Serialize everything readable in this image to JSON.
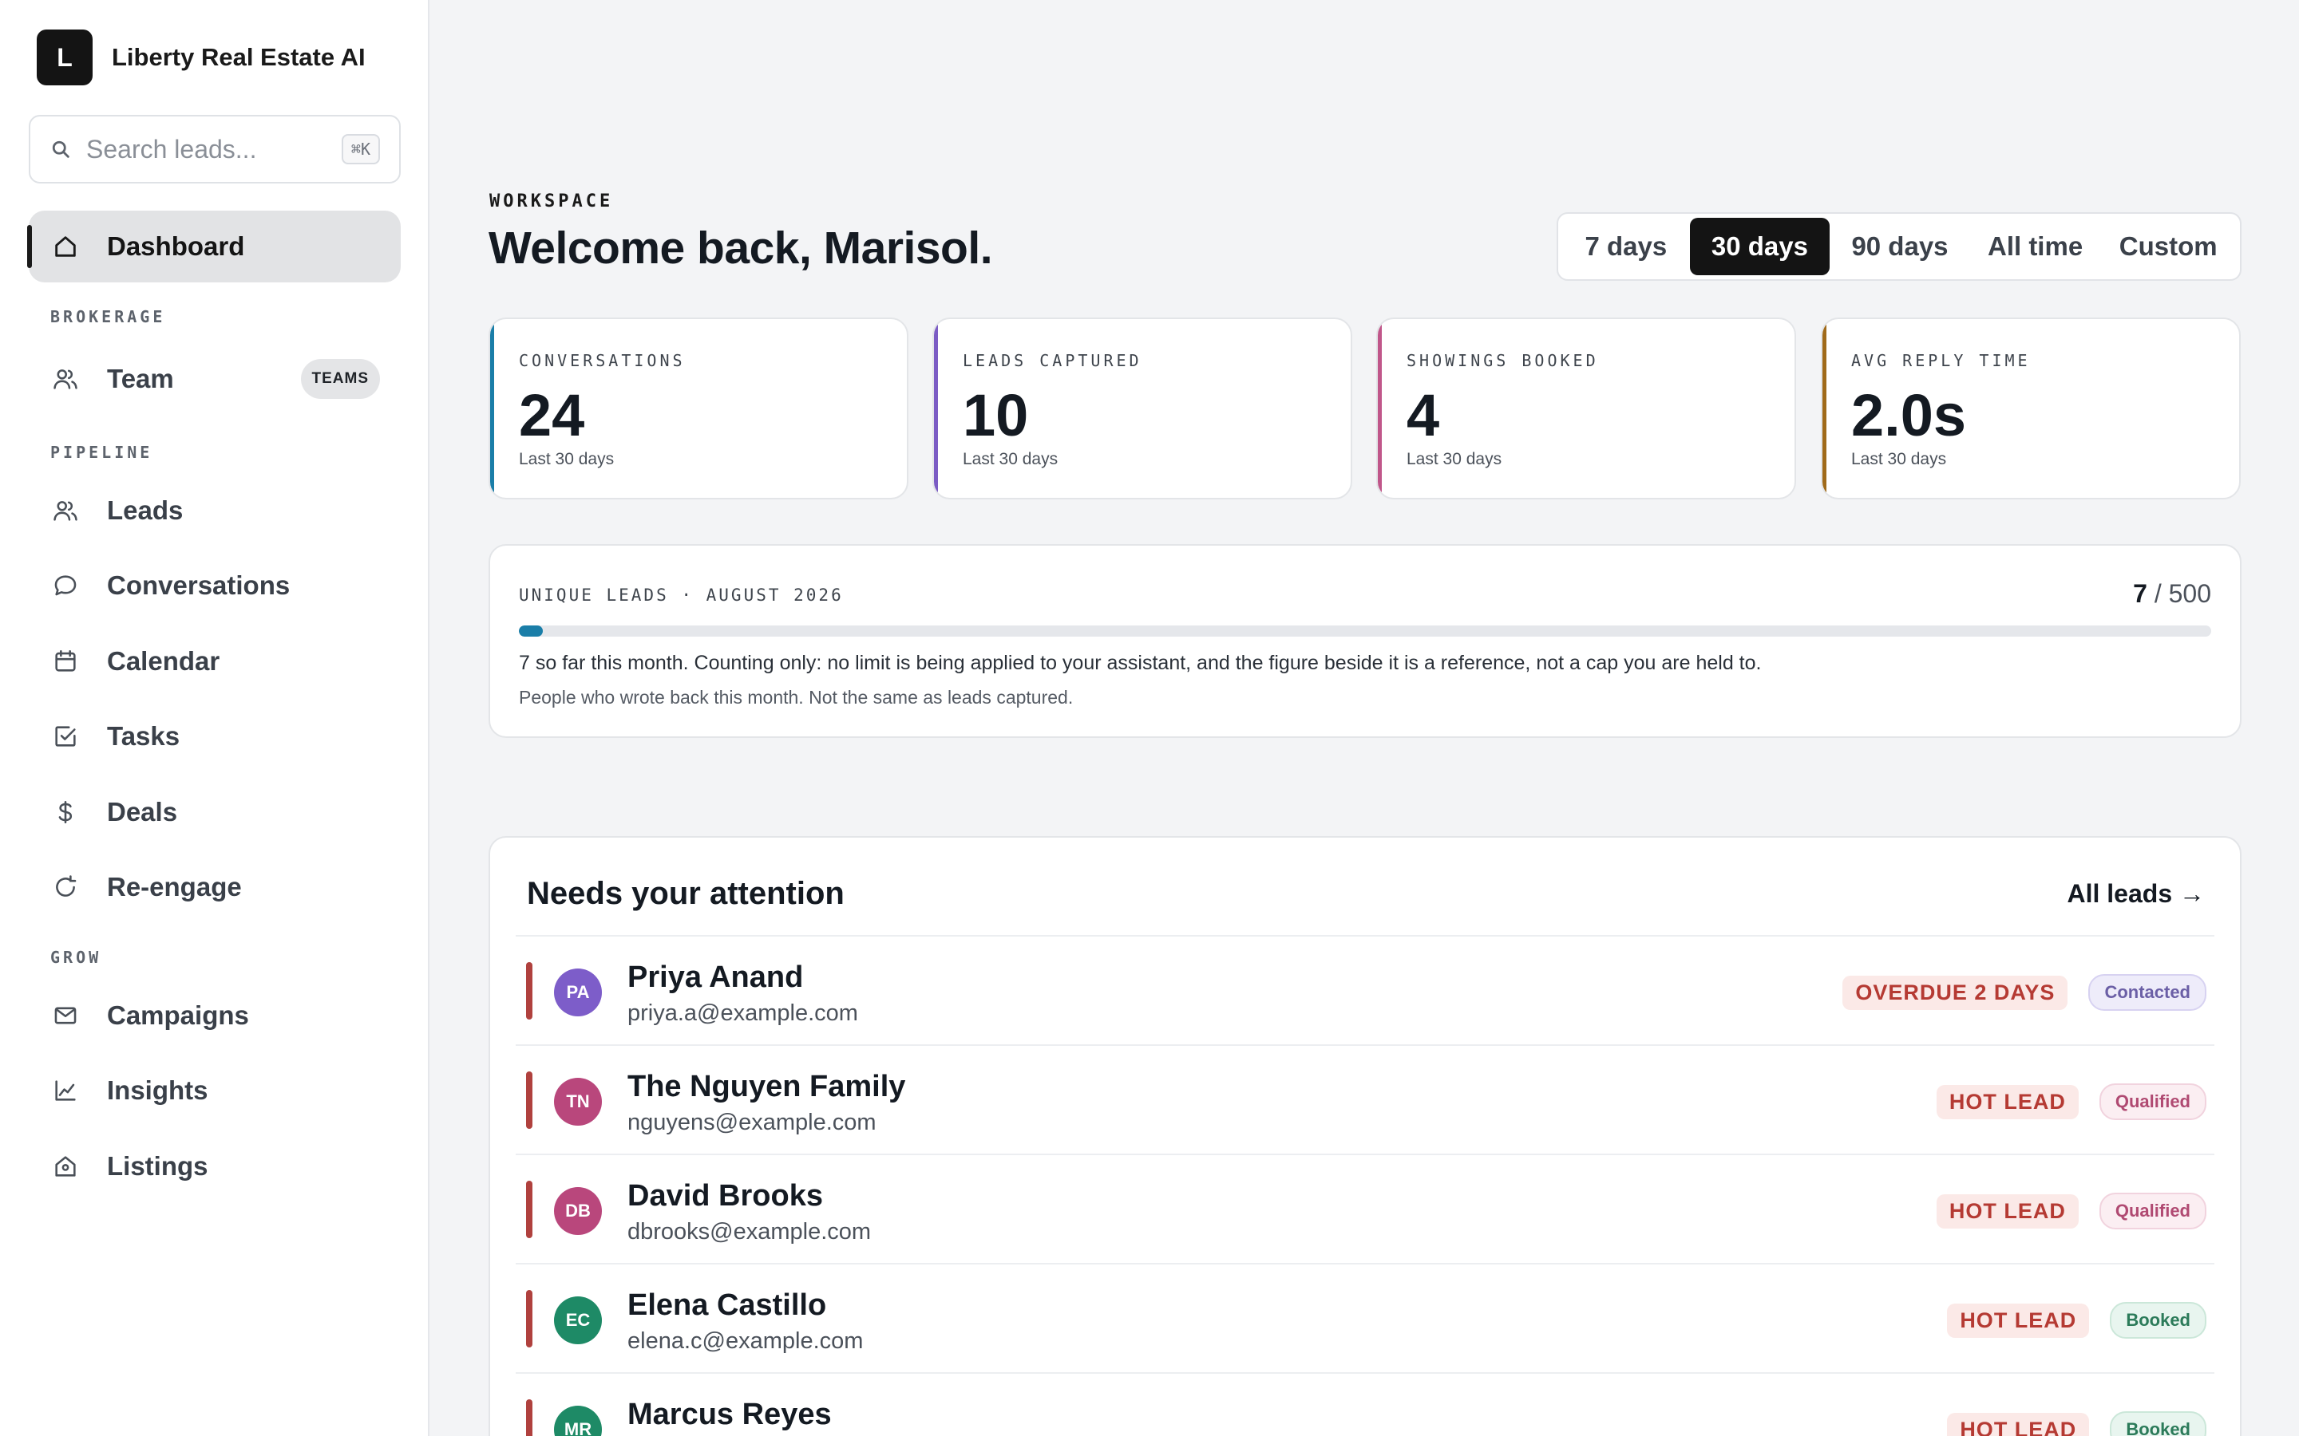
{
  "brand": {
    "logo_letter": "L",
    "name": "Liberty Real Estate AI"
  },
  "search": {
    "placeholder": "Search leads...",
    "shortcut": "⌘K"
  },
  "sidebar": {
    "dashboard": {
      "label": "Dashboard",
      "icon": "home-icon"
    },
    "section_brokerage": "BROKERAGE",
    "team": {
      "label": "Team",
      "icon": "users-icon",
      "badge": "TEAMS"
    },
    "section_pipeline": "PIPELINE",
    "leads": {
      "label": "Leads",
      "icon": "users-icon"
    },
    "conversations": {
      "label": "Conversations",
      "icon": "chat-bubble-icon"
    },
    "calendar": {
      "label": "Calendar",
      "icon": "calendar-icon"
    },
    "tasks": {
      "label": "Tasks",
      "icon": "checkbox-icon"
    },
    "deals": {
      "label": "Deals",
      "icon": "dollar-icon"
    },
    "reengage": {
      "label": "Re-engage",
      "icon": "refresh-icon"
    },
    "section_grow": "GROW",
    "campaigns": {
      "label": "Campaigns",
      "icon": "mail-icon"
    },
    "insights": {
      "label": "Insights",
      "icon": "line-chart-icon"
    },
    "listings": {
      "label": "Listings",
      "icon": "house-icon"
    }
  },
  "header": {
    "eyebrow": "WORKSPACE",
    "welcome": "Welcome back, Marisol."
  },
  "range": {
    "options": [
      "7 days",
      "30 days",
      "90 days",
      "All time",
      "Custom"
    ],
    "selected": "30 days"
  },
  "stats": [
    {
      "label": "CONVERSATIONS",
      "value": "24",
      "sub": "Last 30 days",
      "accent": "#1a7ea8"
    },
    {
      "label": "LEADS CAPTURED",
      "value": "10",
      "sub": "Last 30 days",
      "accent": "#7b5cc4"
    },
    {
      "label": "SHOWINGS BOOKED",
      "value": "4",
      "sub": "Last 30 days",
      "accent": "#c0568a"
    },
    {
      "label": "AVG REPLY TIME",
      "value": "2.0s",
      "sub": "Last 30 days",
      "accent": "#a06a1a"
    }
  ],
  "unique_leads": {
    "label": "UNIQUE LEADS · AUGUST 2026",
    "count": "7",
    "reference": "/ 500",
    "progress_fraction": 0.014,
    "note": "7 so far this month. Counting only: no limit is being applied to your assistant, and the figure beside it is a reference, not a cap you are held to.",
    "sub": "People who wrote back this month. Not the same as leads captured."
  },
  "attention": {
    "title": "Needs your attention",
    "link": "All leads →",
    "rows": [
      {
        "initials": "PA",
        "name": "Priya Anand",
        "email": "priya.a@example.com",
        "alert": "OVERDUE 2 DAYS",
        "status": "Contacted",
        "status_kind": "contacted",
        "avatar_color": "#7d5dc9"
      },
      {
        "initials": "TN",
        "name": "The Nguyen Family",
        "email": "nguyens@example.com",
        "alert": "HOT LEAD",
        "status": "Qualified",
        "status_kind": "qualified",
        "avatar_color": "#b9477c"
      },
      {
        "initials": "DB",
        "name": "David Brooks",
        "email": "dbrooks@example.com",
        "alert": "HOT LEAD",
        "status": "Qualified",
        "status_kind": "qualified",
        "avatar_color": "#b9477c"
      },
      {
        "initials": "EC",
        "name": "Elena Castillo",
        "email": "elena.c@example.com",
        "alert": "HOT LEAD",
        "status": "Booked",
        "status_kind": "booked",
        "avatar_color": "#1e8a66"
      },
      {
        "initials": "MR",
        "name": "Marcus Reyes",
        "email": "",
        "alert": "HOT LEAD",
        "status": "Booked",
        "status_kind": "booked",
        "avatar_color": "#1e8a66"
      }
    ]
  }
}
